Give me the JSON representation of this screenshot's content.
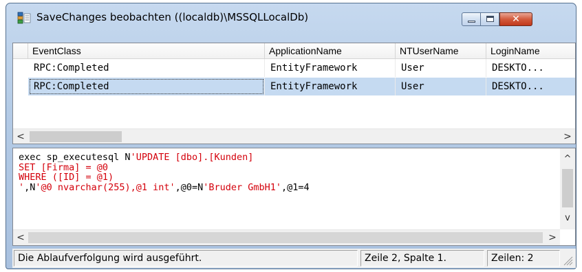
{
  "window": {
    "title": "SaveChanges beobachten ((localdb)\\MSSQLLocalDb)",
    "caption_buttons": {
      "minimize": "",
      "maximize": "",
      "close": "✕"
    }
  },
  "grid": {
    "columns": [
      "EventClass",
      "ApplicationName",
      "NTUserName",
      "LoginName"
    ],
    "rows": [
      {
        "EventClass": "RPC:Completed",
        "ApplicationName": "EntityFramework",
        "NTUserName": "User",
        "LoginName": "DESKTO..."
      },
      {
        "EventClass": "RPC:Completed",
        "ApplicationName": "EntityFramework",
        "NTUserName": "User",
        "LoginName": "DESKTO..."
      }
    ],
    "selected_row_index": 1,
    "scroll": {
      "left_arrow": "<",
      "right_arrow": ">"
    }
  },
  "sql": {
    "lines": [
      [
        {
          "t": "exec sp_executesql N",
          "c": "blk"
        },
        {
          "t": "'UPDATE [dbo].[Kunden]",
          "c": "red"
        }
      ],
      [
        {
          "t": "SET [Firma] = @0",
          "c": "red"
        }
      ],
      [
        {
          "t": "WHERE ([ID] = @1)",
          "c": "red"
        }
      ],
      [
        {
          "t": "'",
          "c": "red"
        },
        {
          "t": ",N",
          "c": "blk"
        },
        {
          "t": "'@0 nvarchar(255),@1 int'",
          "c": "red"
        },
        {
          "t": ",@0=N",
          "c": "blk"
        },
        {
          "t": "'Bruder GmbH1'",
          "c": "red"
        },
        {
          "t": ",@1=4",
          "c": "blk"
        }
      ]
    ],
    "scroll": {
      "up_arrow": "^",
      "down_arrow": "v",
      "left_arrow": "<",
      "right_arrow": ">"
    }
  },
  "status": {
    "message": "Die Ablaufverfolgung wird ausgeführt.",
    "position": "Zeile 2, Spalte 1.",
    "rows": "Zeilen: 2"
  },
  "colors": {
    "selection": "#c5daf1",
    "sql_keyword": "#d4000b",
    "close_button": "#c0381c"
  }
}
